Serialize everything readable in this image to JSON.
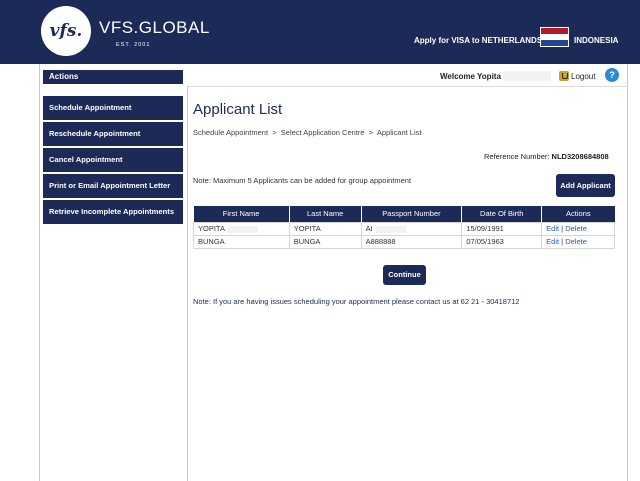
{
  "header": {
    "logo_text": "vfs.",
    "brand": "VFS.GLOBAL",
    "est": "EST. 2001",
    "apply_text": "Apply for VISA to NETHERLANDS",
    "country": "INDONESIA",
    "colors": {
      "brand_navy": "#1c2a57",
      "flag_red": "#ae1c28",
      "flag_white": "#ffffff",
      "flag_blue": "#21468b"
    }
  },
  "sidebar": {
    "title": "Actions",
    "items": [
      {
        "label": "Schedule Appointment"
      },
      {
        "label": "Reschedule Appointment"
      },
      {
        "label": "Cancel Appointment"
      },
      {
        "label": "Print or Email Appointment Letter"
      },
      {
        "label": "Retrieve Incomplete Appointments"
      }
    ]
  },
  "topbar": {
    "welcome": "Welcome Yopita",
    "logout": "Logout",
    "help": "?"
  },
  "main": {
    "title": "Applicant List",
    "breadcrumb": "Schedule Appointment  >  Select Application Centre  >  Applicant List",
    "reference_label": "Reference Number:",
    "reference_value": "NLD3208684808",
    "note_max": "Note: Maximum 5 Applicants can be added for group appointment",
    "add_button": "Add Applicant",
    "table": {
      "headers": [
        "First Name",
        "Last Name",
        "Passport Number",
        "Date Of Birth",
        "Actions"
      ],
      "rows": [
        {
          "first": "YOPITA",
          "last": "YOPITA",
          "passport": "AI",
          "dob": "15/09/1991",
          "edit": "Edit",
          "delete": "Delete"
        },
        {
          "first": "BUNGA",
          "last": "BUNGA",
          "passport": "A888888",
          "dob": "07/05/1963",
          "edit": "Edit",
          "delete": "Delete"
        }
      ]
    },
    "continue_button": "Continue",
    "note_contact": "Note: If you are having issues scheduling your appointment please contact us at 62 21 - 30418712"
  }
}
